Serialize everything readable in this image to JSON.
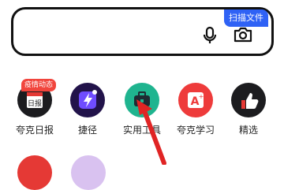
{
  "search": {
    "scan_badge": "扫描文件"
  },
  "shortcuts": [
    {
      "label": "夸克日报",
      "icon": "calendar-newspaper-icon"
    },
    {
      "label": "捷径",
      "icon": "lightning-shortcut-icon"
    },
    {
      "label": "实用工具",
      "icon": "toolbox-icon"
    },
    {
      "label": "夸克学习",
      "icon": "study-a-icon"
    },
    {
      "label": "精选",
      "icon": "thumbs-up-icon"
    }
  ],
  "badges": {
    "epidemic": "疫情动态"
  },
  "colors": {
    "scan_badge_bg": "#2f62f5",
    "epidemic_badge_bg": "#f1453d",
    "pointer_arrow": "#e02424"
  }
}
